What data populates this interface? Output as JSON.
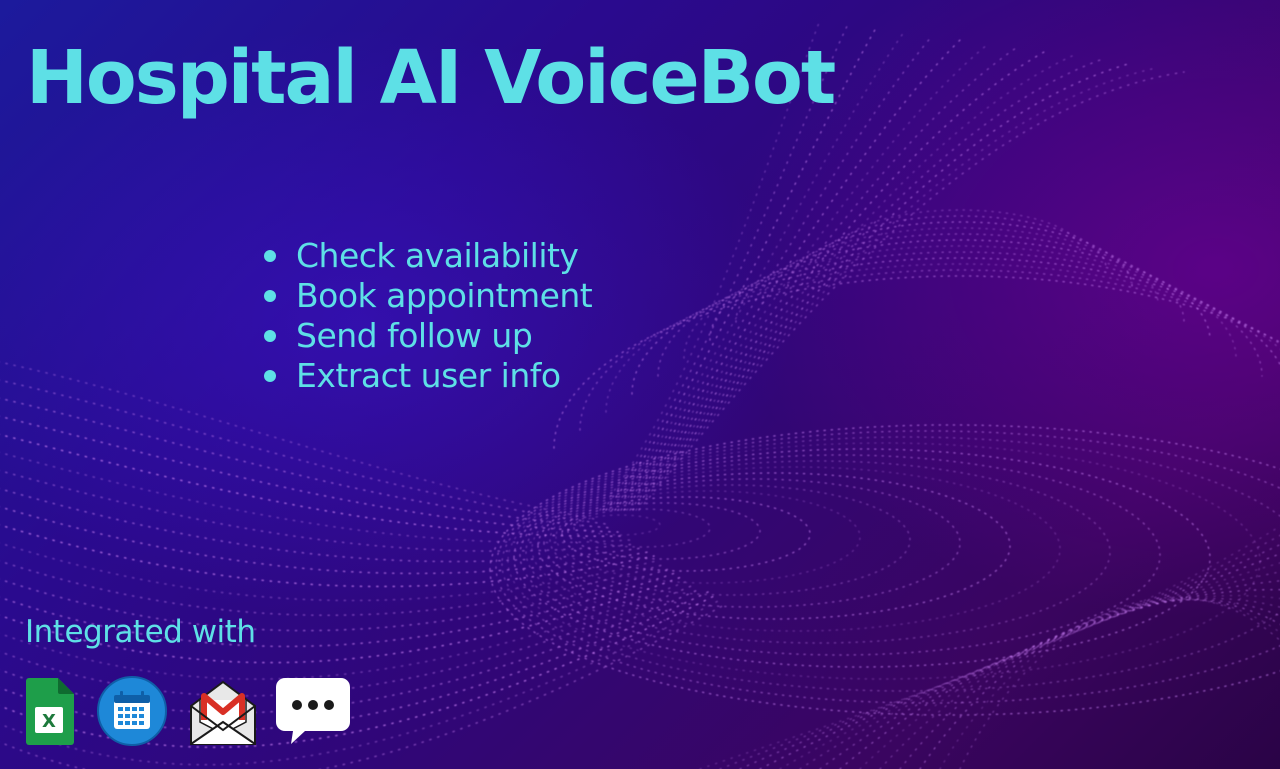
{
  "title": "Hospital AI VoiceBot",
  "features": [
    "Check availability",
    "Book appointment",
    "Send follow up",
    "Extract user info"
  ],
  "integrations": {
    "label": "Integrated with",
    "icons": [
      "spreadsheet-icon",
      "calendar-icon",
      "gmail-icon",
      "chat-icon"
    ]
  },
  "colors": {
    "accent": "#5ee0e6",
    "background_start": "#1c1a9c",
    "background_end": "#3a0560",
    "particles": "#c77df2"
  }
}
